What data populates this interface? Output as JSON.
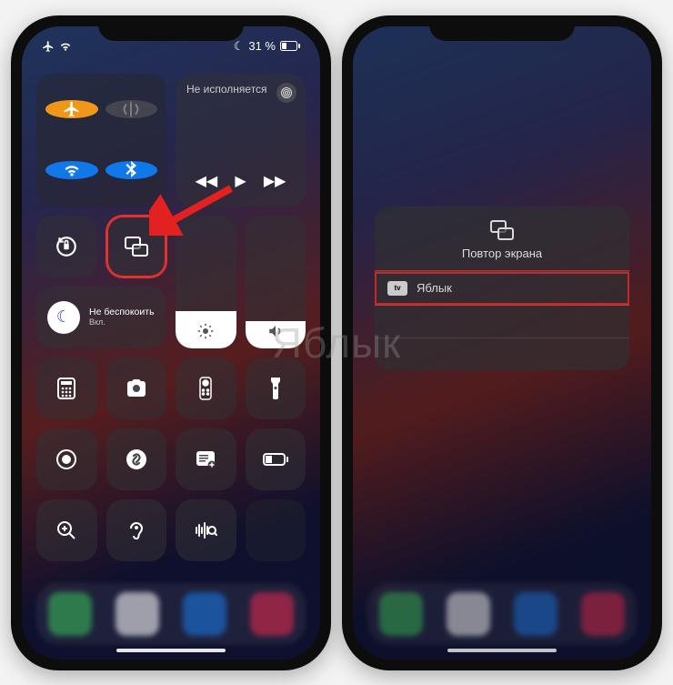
{
  "status": {
    "battery_pct": "31 %"
  },
  "media": {
    "not_playing": "Не исполняется"
  },
  "focus": {
    "title": "Не беспокоить",
    "subtitle": "Вкл."
  },
  "icons": {
    "airplane": "airplane-icon",
    "wifi": "wifi-icon",
    "bluetooth": "bluetooth-icon",
    "antenna": "cellular-icon",
    "lock_rotation": "rotation-lock-icon",
    "screen_mirroring": "screen-mirroring-icon",
    "brightness": "brightness-icon",
    "volume": "volume-icon",
    "calculator": "calculator-icon",
    "camera": "camera-icon",
    "remote": "apple-tv-remote-icon",
    "flashlight": "flashlight-icon",
    "record": "screen-record-icon",
    "shazam": "shazam-icon",
    "notes": "quick-note-icon",
    "low_power": "low-power-icon",
    "magnifier": "magnifier-icon",
    "hearing": "hearing-icon",
    "sound_recognition": "sound-recognition-icon",
    "airplay_corner": "airplay-icon",
    "rewind": "◀◀",
    "play": "▶",
    "forward": "▶▶",
    "moon": "☾"
  },
  "popup": {
    "title": "Повтор экрана",
    "device": "Яблык",
    "device_badge": "tv"
  },
  "watermark": "Яблык"
}
